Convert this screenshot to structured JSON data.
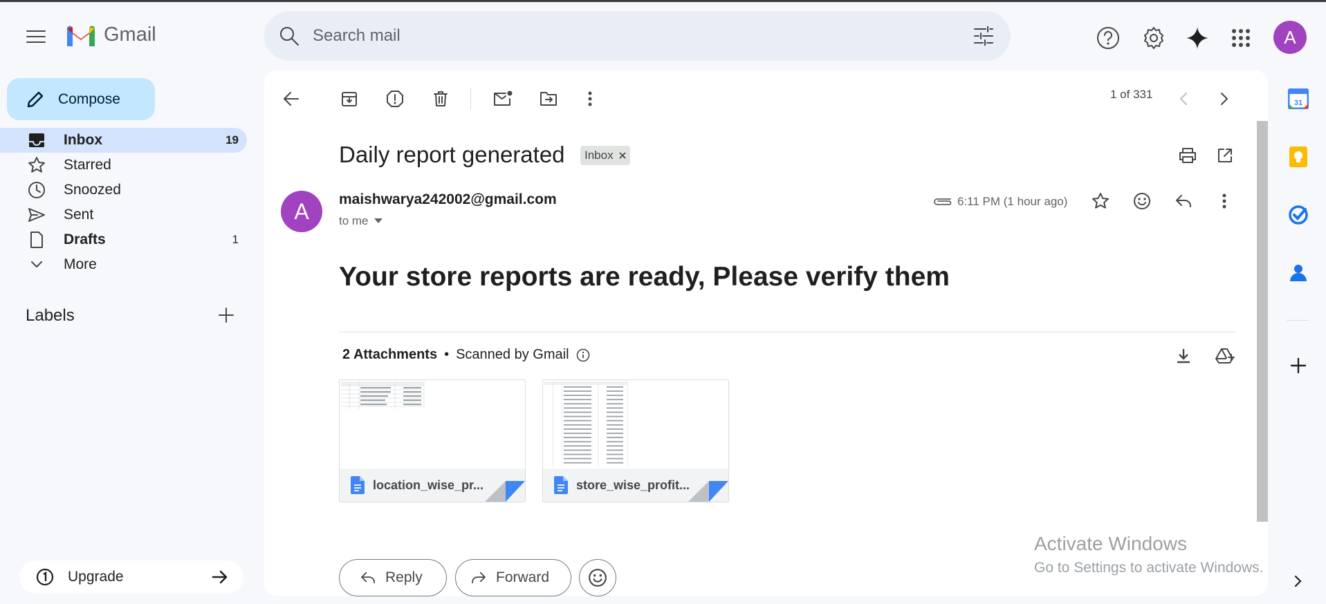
{
  "app": {
    "name": "Gmail"
  },
  "search": {
    "placeholder": "Search mail"
  },
  "header": {
    "avatar_letter": "A"
  },
  "compose": {
    "label": "Compose"
  },
  "nav": [
    {
      "label": "Inbox",
      "count": "19",
      "icon": "inbox-icon"
    },
    {
      "label": "Starred",
      "count": "",
      "icon": "star-icon"
    },
    {
      "label": "Snoozed",
      "count": "",
      "icon": "clock-icon"
    },
    {
      "label": "Sent",
      "count": "",
      "icon": "send-icon"
    },
    {
      "label": "Drafts",
      "count": "1",
      "icon": "draft-icon"
    },
    {
      "label": "More",
      "count": "",
      "icon": "chevron-down-icon"
    }
  ],
  "labels": {
    "heading": "Labels"
  },
  "upgrade": {
    "label": "Upgrade"
  },
  "toolbar": {
    "pager": "1 of 331"
  },
  "email": {
    "subject": "Daily report generated",
    "chip": "Inbox",
    "avatar_letter": "A",
    "sender": "maishwarya242002@gmail.com",
    "recipient": "to me",
    "time": "6:11 PM (1 hour ago)",
    "body_heading": "Your store reports are ready, Please verify them"
  },
  "attachments": {
    "heading": "2 Attachments",
    "scanned": "Scanned by Gmail",
    "files": [
      {
        "name": "location_wise_pr..."
      },
      {
        "name": "store_wise_profit..."
      }
    ]
  },
  "actions": {
    "reply": "Reply",
    "forward": "Forward"
  },
  "watermark": {
    "line1": "Activate Windows",
    "line2": "Go to Settings to activate Windows."
  },
  "colors": {
    "accent": "#0b57d0",
    "compose_bg": "#c2e7ff",
    "active_nav": "#d3e3fd",
    "avatar": "#a142c1"
  }
}
